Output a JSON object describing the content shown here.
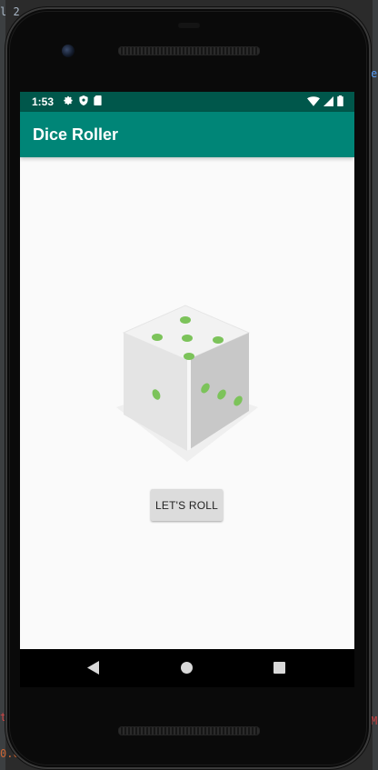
{
  "ide": {
    "top_left_fragment": "l 2",
    "right_fragment": "e",
    "bottom_left_fragment_1": "t",
    "bottom_left_fragment_2": "0.0",
    "bottom_right_fragment": "M"
  },
  "status_bar": {
    "time": "1:53",
    "left_icons": [
      "gear-icon",
      "shield-icon",
      "sd-card-icon"
    ],
    "right_icons": [
      "wifi-icon",
      "signal-icon",
      "battery-icon"
    ],
    "color": "#00574b"
  },
  "app_bar": {
    "title": "Dice Roller",
    "color": "#008577"
  },
  "dice": {
    "top_face_pips": 5,
    "left_face_pips": 1,
    "right_face_pips": 3,
    "pip_color": "#7cc35a"
  },
  "roll_button": {
    "label": "LET'S ROLL"
  },
  "nav_bar": {
    "back": "back-icon",
    "home": "home-icon",
    "recents": "recents-icon"
  }
}
